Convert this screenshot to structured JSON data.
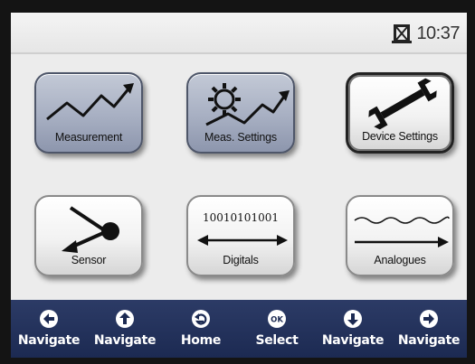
{
  "status": {
    "clock": "10:37",
    "storage_icon": "sd-card-icon"
  },
  "tiles": [
    {
      "label": "Measurement",
      "icon": "trend-chart-icon",
      "state": "dark"
    },
    {
      "label": "Meas. Settings",
      "icon": "gear-trend-icon",
      "state": "dark"
    },
    {
      "label": "Device Settings",
      "icon": "wrench-icon",
      "state": "selected"
    },
    {
      "label": "Sensor",
      "icon": "sensor-probe-icon",
      "state": "normal"
    },
    {
      "label": "Digitals",
      "icon": "binary-arrow-icon",
      "state": "normal",
      "binary": "10010101001"
    },
    {
      "label": "Analogues",
      "icon": "wave-arrow-icon",
      "state": "normal"
    }
  ],
  "nav": [
    {
      "label": "Navigate",
      "icon": "arrow-left-icon"
    },
    {
      "label": "Navigate",
      "icon": "arrow-up-icon"
    },
    {
      "label": "Home",
      "icon": "home-return-icon"
    },
    {
      "label": "Select",
      "icon": "ok-icon",
      "icon_text": "OK"
    },
    {
      "label": "Navigate",
      "icon": "arrow-down-icon"
    },
    {
      "label": "Navigate",
      "icon": "arrow-right-icon"
    }
  ],
  "colors": {
    "nav_bar": "#1c2a52",
    "tile_dark": "#a7afc2",
    "tile_light": "#f2f2f2"
  }
}
